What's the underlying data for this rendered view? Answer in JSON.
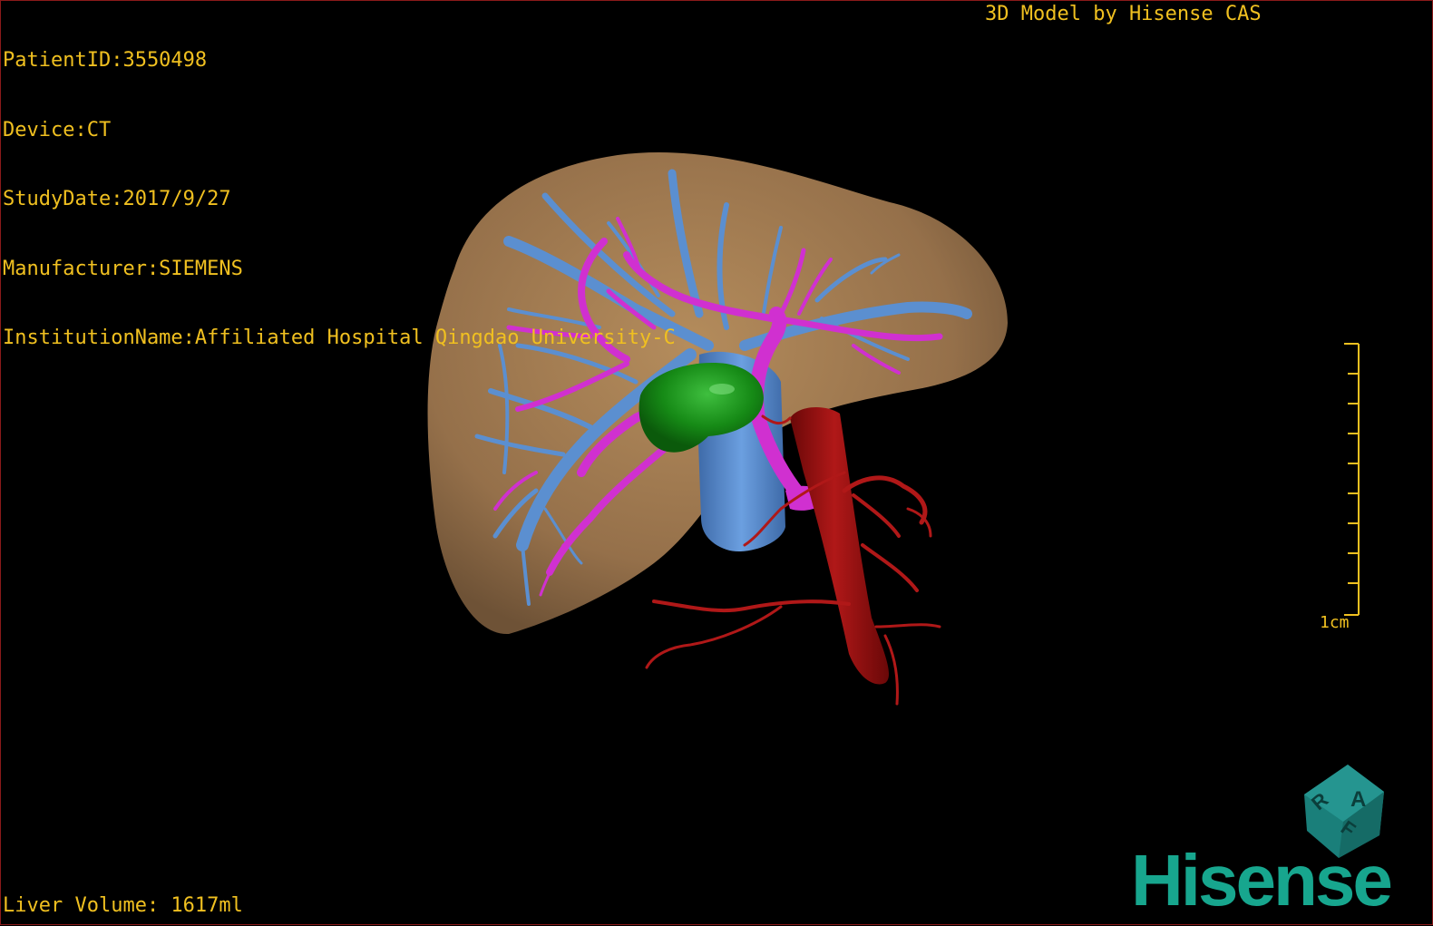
{
  "patient_info": {
    "patient_id": "PatientID:3550498",
    "device": "Device:CT",
    "study_date": "StudyDate:2017/9/27",
    "manufacturer": "Manufacturer:SIEMENS",
    "institution": "InstitutionName:Affiliated Hospital Qingdao University-C"
  },
  "header": {
    "model_credit": "3D Model by Hisense CAS"
  },
  "footer": {
    "liver_volume": "Liver Volume: 1617ml"
  },
  "scale_bar": {
    "label": "1cm"
  },
  "orientation_cube": {
    "faces": [
      "A",
      "R",
      "F"
    ]
  },
  "brand": {
    "logo_text": "Hisense"
  },
  "colors": {
    "text": "#f0c020",
    "liver": "#a07a50",
    "hepatic_vein": "#5b8fd0",
    "portal_vein": "#d030d0",
    "gallbladder": "#1a8a1a",
    "aorta": "#9a1010",
    "brand": "#17a68e"
  }
}
